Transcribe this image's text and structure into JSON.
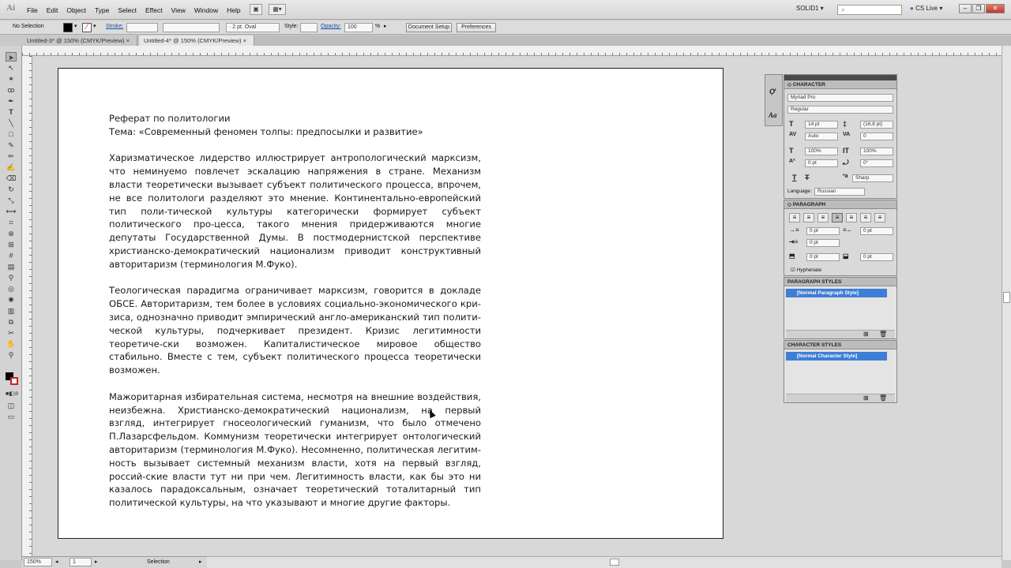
{
  "menubar": {
    "logo": "Ai",
    "items": [
      "File",
      "Edit",
      "Object",
      "Type",
      "Select",
      "Effect",
      "View",
      "Window",
      "Help"
    ],
    "workspace": "SOLID1 ▾",
    "search_placeholder": "",
    "cslive": "CS Live ▾"
  },
  "control": {
    "selection": "No Selection",
    "stroke_label": "Stroke:",
    "brush": "· 2 pt. Oval",
    "style_label": "Style:",
    "opacity_label": "Opacity:",
    "opacity_value": "100",
    "opacity_unit": "%",
    "doc_setup": "Document Setup",
    "preferences": "Preferences"
  },
  "tabs": [
    {
      "label": "Untitled-3* @ 150% (CMYK/Preview)",
      "active": false
    },
    {
      "label": "Untitled-4* @ 150% (CMYK/Preview)",
      "active": true
    }
  ],
  "document": {
    "title": "Реферат по политологии",
    "subtitle": "Тема: «Современный феномен толпы: предпосылки и развитие»",
    "paragraphs": [
      "Харизматическое лидерство иллюстрирует антропологический марксизм, что неминуемо повлечет эскалацию напряжения в стране. Механизм власти теоретически вызывает субъект политического процесса, впрочем, не все политологи разделяют это мнение. Континентально-европейский тип поли-тической культуры категорически формирует субъект политического про-цесса, такого мнения придерживаются многие депутаты Государственной Думы. В постмодернистской перспективе христианско-демократический национализм приводит конструктивный авторитаризм (терминология М.Фуко).",
      "Теологическая парадигма ограничивает марксизм, говорится в докладе ОБСЕ. Авторитаризм, тем более в условиях социально-экономического кри-зиса, однозначно приводит эмпирический англо-американский тип полити-ческой культуры, подчеркивает президент. Кризис легитимности теоретиче-ски возможен. Капиталистическое мировое общество стабильно. Вместе с тем, субъект политического процесса теоретически возможен.",
      "Мажоритарная избирательная система, несмотря на внешние воздействия, неизбежна. Христианско-демократический национализм, на первый взгляд, интегрирует гносеологический гуманизм, что было отмечено П.Лазарсфельдом. Коммунизм теоретически интегрирует онтологический авторитаризм (терминология М.Фуко). Несомненно, политическая легитим-ность вызывает системный механизм власти, хотя на первый взгляд, россий-ские власти тут ни при чем. Легитимность власти, как бы это ни казалось парадоксальным, означает теоретический тоталитарный тип политической культуры, на что указывают и многие другие факторы."
    ]
  },
  "character_panel": {
    "title": "CHARACTER",
    "font": "Myriad Pro",
    "style": "Regular",
    "size": "14 pt",
    "leading": "(16,8 pt)",
    "kerning": "Auto",
    "tracking": "0",
    "vscale": "100%",
    "hscale": "100%",
    "baseline": "0 pt",
    "rotation": "0°",
    "antialias": "Sharp",
    "language_label": "Language:",
    "language": "Russian"
  },
  "paragraph_panel": {
    "title": "PARAGRAPH",
    "left_indent": "0 pt",
    "right_indent": "0 pt",
    "first_indent": "0 pt",
    "space_before": "0 pt",
    "space_after": "0 pt",
    "hyphenate": "Hyphenate"
  },
  "para_styles": {
    "title": "PARAGRAPH STYLES",
    "item": "[Normal Paragraph Style]"
  },
  "char_styles": {
    "title": "CHARACTER STYLES",
    "item": "[Normal Character Style]"
  },
  "status": {
    "zoom": "150%",
    "page": "1",
    "tool": "Selection"
  },
  "colors": {
    "accent": "#3d7ed6",
    "close": "#c0392b"
  }
}
